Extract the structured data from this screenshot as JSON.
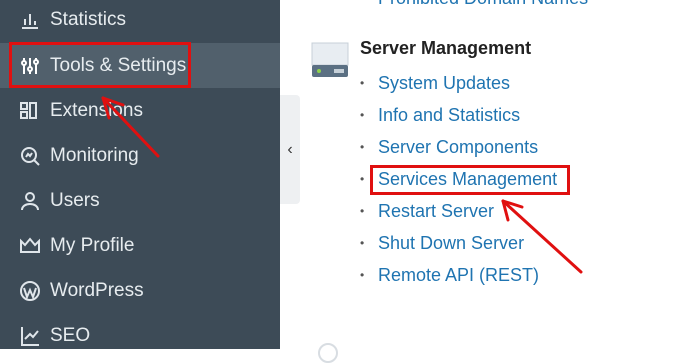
{
  "sidebar": {
    "items": [
      {
        "label": "Statistics",
        "icon": "bar-chart-icon"
      },
      {
        "label": "Tools & Settings",
        "icon": "sliders-icon",
        "active": true
      },
      {
        "label": "Extensions",
        "icon": "extensions-icon"
      },
      {
        "label": "Monitoring",
        "icon": "monitoring-icon"
      },
      {
        "label": "Users",
        "icon": "user-icon"
      },
      {
        "label": "My Profile",
        "icon": "crown-icon"
      },
      {
        "label": "WordPress",
        "icon": "wordpress-icon"
      },
      {
        "label": "SEO",
        "icon": "seo-icon"
      }
    ],
    "collapse_glyph": "‹"
  },
  "main": {
    "top_link": "Prohibited Domain Names",
    "section": {
      "title": "Server Management",
      "icon": "server-icon",
      "links": [
        "System Updates",
        "Info and Statistics",
        "Server Components",
        "Services Management",
        "Restart Server",
        "Shut Down Server",
        "Remote API (REST)"
      ]
    }
  },
  "colors": {
    "sidebar_bg": "#3d4b57",
    "sidebar_active": "#51606c",
    "link": "#1f74b1",
    "annotation": "#e01010"
  }
}
